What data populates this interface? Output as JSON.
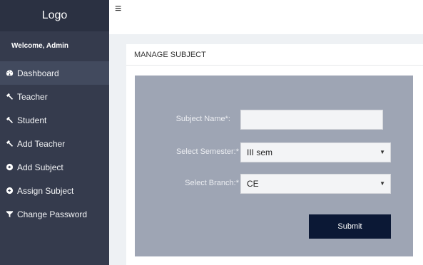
{
  "sidebar": {
    "logo": "Logo",
    "welcome": "Welcome, Admin",
    "items": [
      {
        "label": "Dashboard",
        "icon": "dashboard-icon"
      },
      {
        "label": "Teacher",
        "icon": "wrench-icon"
      },
      {
        "label": "Student",
        "icon": "wrench-icon"
      },
      {
        "label": "Add Teacher",
        "icon": "wrench-icon"
      },
      {
        "label": "Add Subject",
        "icon": "circle-arrow-icon"
      },
      {
        "label": "Assign Subject",
        "icon": "circle-arrow-icon"
      },
      {
        "label": "Change Password",
        "icon": "filter-icon"
      }
    ]
  },
  "topbar": {
    "menu_glyph": "≡"
  },
  "panel": {
    "title": "MANAGE SUBJECT",
    "form": {
      "subject_name_label": "Subject Name*:",
      "subject_name_value": "",
      "semester_label": "Select Semester:*",
      "semester_value": "III sem",
      "branch_label": "Select Branch:*",
      "branch_value": "CE",
      "submit_label": "Submit"
    }
  },
  "colors": {
    "sidebar_bg": "#353b4d",
    "logo_bg": "#2b3142",
    "active_item": "#424a5e",
    "form_bg": "#9ea5b4",
    "submit_bg": "#0b1835"
  }
}
